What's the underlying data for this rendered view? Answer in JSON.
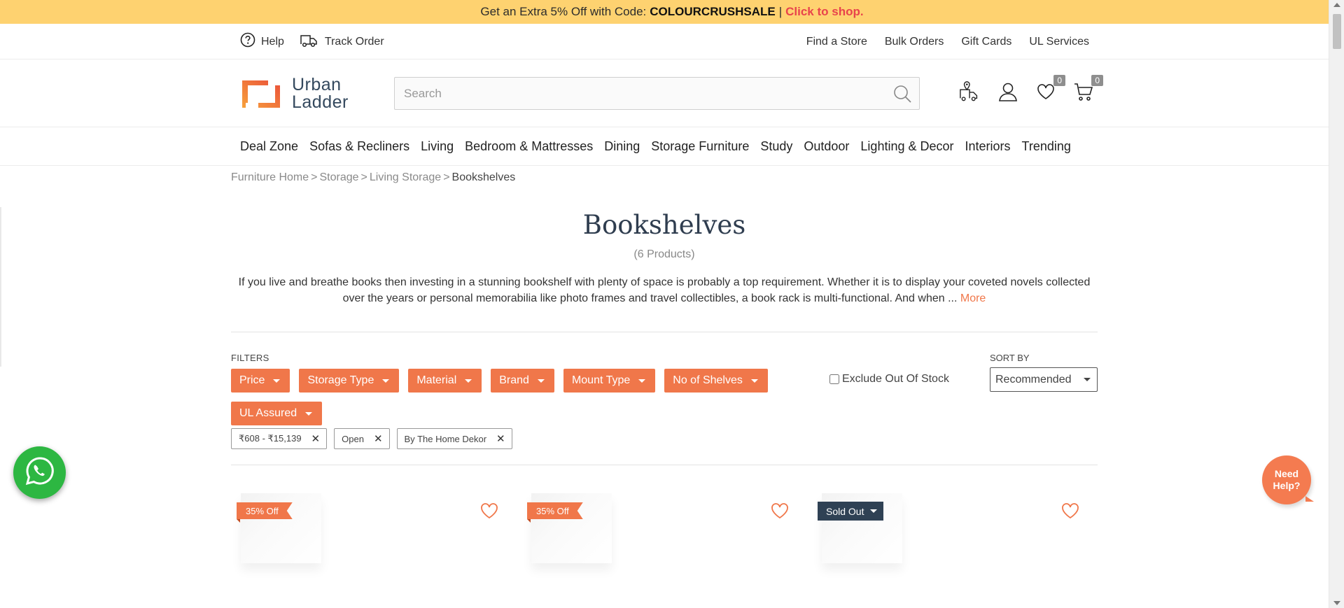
{
  "promo": {
    "text": "Get an Extra 5% Off with Code:",
    "code": "COLOURCRUSHSALE",
    "separator": "|",
    "cta": "Click to shop."
  },
  "utility": {
    "help": "Help",
    "track_order": "Track Order",
    "links": [
      "Find a Store",
      "Bulk Orders",
      "Gift Cards",
      "UL Services"
    ]
  },
  "logo": {
    "line1": "Urban",
    "line2": "Ladder"
  },
  "search": {
    "placeholder": "Search"
  },
  "header_icons": {
    "wishlist_count": "0",
    "cart_count": "0"
  },
  "categories": [
    "Deal Zone",
    "Sofas & Recliners",
    "Living",
    "Bedroom & Mattresses",
    "Dining",
    "Storage Furniture",
    "Study",
    "Outdoor",
    "Lighting & Decor",
    "Interiors",
    "Trending"
  ],
  "breadcrumb": {
    "items": [
      "Furniture Home",
      "Storage",
      "Living Storage"
    ],
    "separator": ">",
    "current": "Bookshelves"
  },
  "page": {
    "title": "Bookshelves",
    "count": "(6 Products)",
    "description": "If you live and breathe books then investing in a stunning bookshelf with plenty of space is probably a top requirement. Whether it is to display your coveted novels collected over the years or personal memorabilia like photo frames and travel collectibles, a book rack is multi-functional. And when ...",
    "more": "More"
  },
  "filters": {
    "label": "FILTERS",
    "buttons": [
      "Price",
      "Storage Type",
      "Material",
      "Brand",
      "Mount Type",
      "No of Shelves",
      "UL Assured"
    ],
    "exclude_oos": "Exclude Out Of Stock",
    "exclude_oos_checked": false
  },
  "sort": {
    "label": "SORT BY",
    "selected": "Recommended"
  },
  "applied_filters": [
    "₹608 - ₹15,139",
    "Open",
    "By The Home Dekor"
  ],
  "products": [
    {
      "tag": "35% Off",
      "tag_type": "discount"
    },
    {
      "tag": "35% Off",
      "tag_type": "discount"
    },
    {
      "tag": "Sold Out",
      "tag_type": "soldout"
    }
  ],
  "need_help": {
    "line1": "Need",
    "line2": "Help?"
  },
  "colors": {
    "accent": "#f0774a",
    "promo_bg": "#fed270",
    "promo_link": "#e8434c",
    "title": "#2f3d4f",
    "soldout": "#2f4154",
    "whatsapp": "#2db742"
  }
}
